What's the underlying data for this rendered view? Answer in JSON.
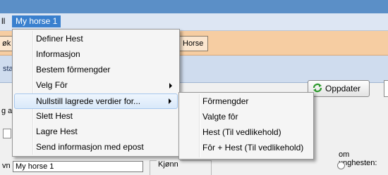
{
  "menubar": {
    "left_fragment": "ll",
    "active_menu": "My horse 1"
  },
  "toolbar": {
    "btn_left_fragment": "øk",
    "btn_right_fragment": "Horse"
  },
  "strip": {
    "label_fragment": "sta"
  },
  "update_button": {
    "label": "Oppdater"
  },
  "background_text": {
    "row1_fragment": "g av",
    "name_label_fragment": "vn",
    "name_value": "My horse 1",
    "gender_label": "Kjønn",
    "right_label": "om unghesten:"
  },
  "main_menu": {
    "items": [
      {
        "label": "Definer Hest",
        "has_submenu": false
      },
      {
        "label": "Informasjon",
        "has_submenu": false
      },
      {
        "label": "Bestem fôrmengder",
        "has_submenu": false
      },
      {
        "label": "Velg Fôr",
        "has_submenu": true
      },
      {
        "label": "Nullstill lagrede verdier for...",
        "has_submenu": true,
        "highlighted": true
      },
      {
        "label": "Slett Hest",
        "has_submenu": false
      },
      {
        "label": "Lagre Hest",
        "has_submenu": false
      },
      {
        "label": "Send informasjon med epost",
        "has_submenu": false
      }
    ]
  },
  "sub_menu": {
    "items": [
      {
        "label": "Fôrmengder"
      },
      {
        "label": "Valgte fôr"
      },
      {
        "label": "Hest (Til vedlikehold)"
      },
      {
        "label": "Fôr + Hest (Til vedlikehold)"
      }
    ]
  },
  "colors": {
    "menubar_active": "#3a80ce",
    "toolbar_bg": "#f6cda2",
    "highlight_border": "#a6c7ee",
    "refresh_icon": "#2e9a2e"
  },
  "icons": {
    "update": "refresh-icon",
    "submenu": "chevron-right-icon"
  }
}
